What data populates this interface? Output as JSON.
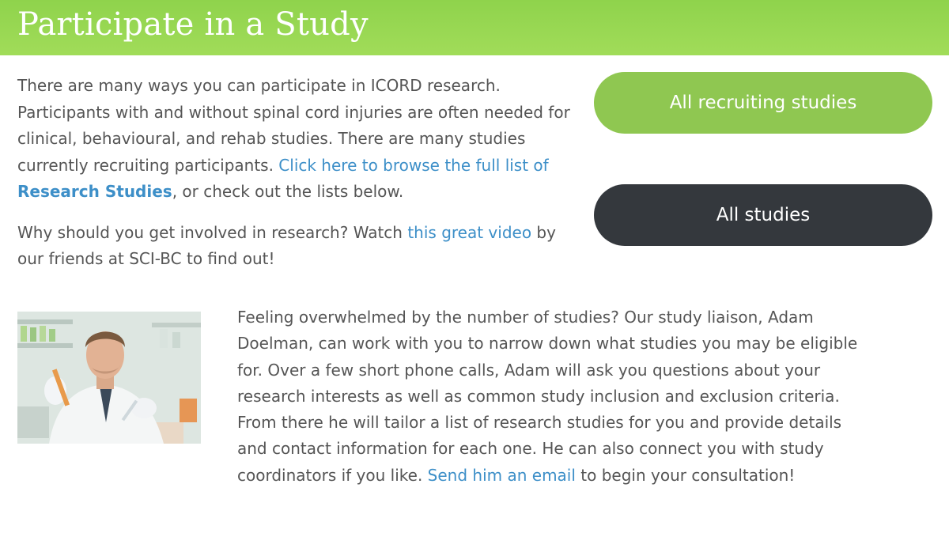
{
  "header": {
    "title": "Participate in a Study"
  },
  "intro": {
    "p1_text": "There are many ways you can participate in ICORD research. Participants with and without spinal cord injuries are often needed for clinical, behavioural, and rehab studies. There are many studies currently recruiting participants. ",
    "p1_link_text": "Click here to browse the full list of ",
    "p1_link_bold": "Research Studies",
    "p1_after": ", or check out the lists below.",
    "p2_text": "Why should you get involved in research? Watch ",
    "p2_link": "this great video",
    "p2_after": " by our friends at SCI-BC to find out!"
  },
  "buttons": {
    "recruiting_label": "All recruiting studies",
    "all_label": "All studies"
  },
  "liaison": {
    "text": "Feeling overwhelmed by the number of studies? Our study liaison, Adam Doelman, can work with you to narrow down what studies you may be eligible for. Over a few short phone calls, Adam will ask you questions about your research interests as well as common study inclusion and exclusion criteria.  From there he will tailor a list of research studies for you and provide details and contact information for each one. He can also connect you with study coordinators if you like. ",
    "link": "Send him an email",
    "after": " to begin your consultation!"
  },
  "colors": {
    "header_green": "#a1dc59",
    "button_green": "#8fc751",
    "button_dark": "#34383d",
    "link_blue": "#3d8fc8",
    "body_text": "#555555"
  }
}
